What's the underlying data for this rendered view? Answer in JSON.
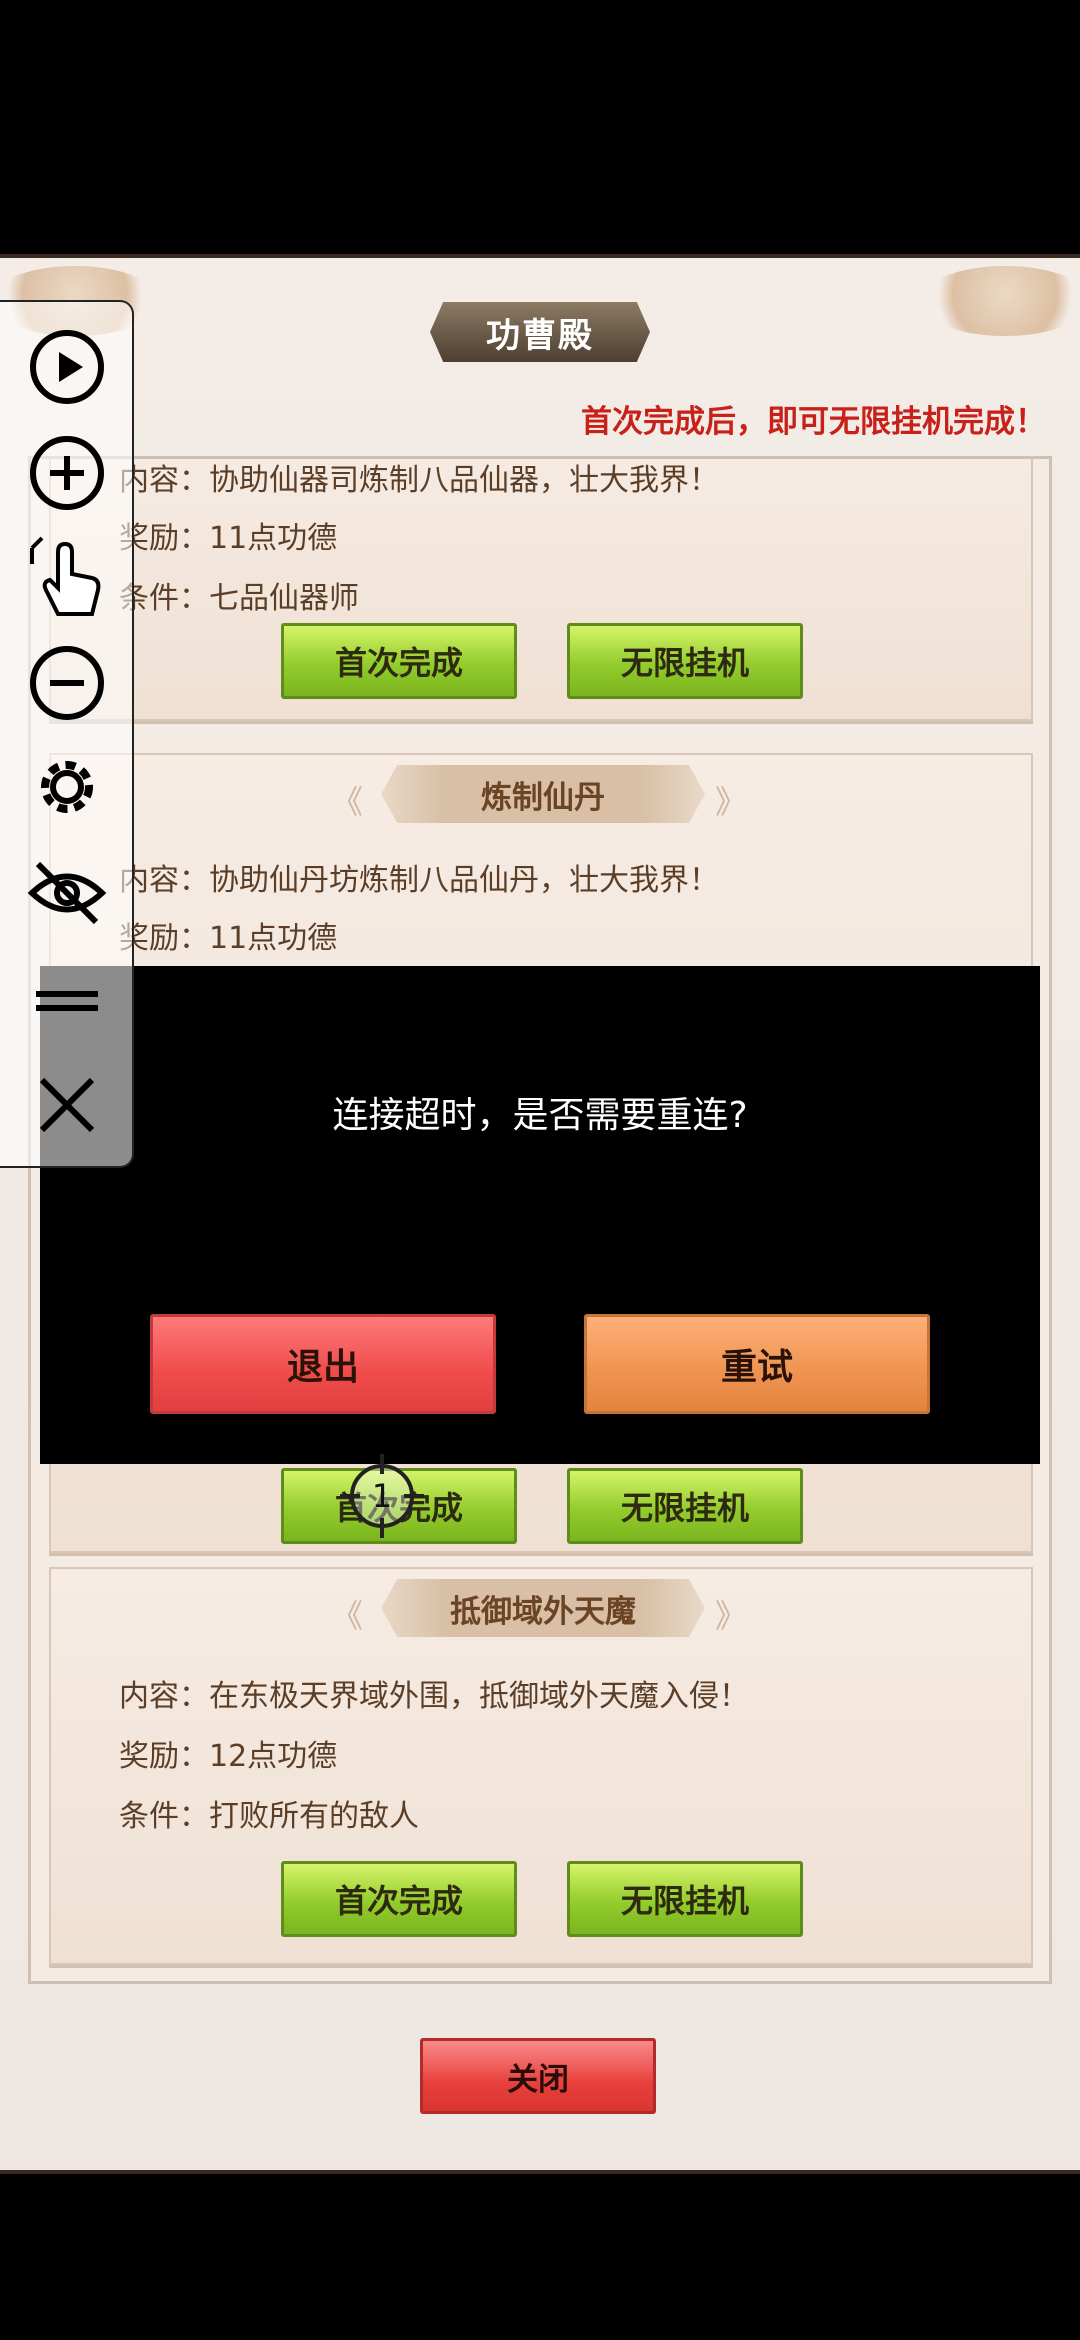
{
  "header": {
    "title": "功曹殿",
    "tip": "首次完成后，即可无限挂机完成！"
  },
  "cards": [
    {
      "content": "内容：协助仙器司炼制八品仙器，壮大我界！",
      "reward": "奖励：11点功德",
      "condition": "条件：七品仙器师",
      "first_label": "首次完成",
      "idle_label": "无限挂机"
    },
    {
      "title": "炼制仙丹",
      "content": "内容：协助仙丹坊炼制八品仙丹，壮大我界！",
      "reward": "奖励：11点功德",
      "first_label": "首次完成",
      "idle_label": "无限挂机"
    },
    {
      "title": "抵御域外天魔",
      "content": "内容：在东极天界域外围，抵御域外天魔入侵！",
      "reward": "奖励：12点功德",
      "condition": "条件：打败所有的敌人",
      "first_label": "首次完成",
      "idle_label": "无限挂机"
    }
  ],
  "footer": {
    "close_label": "关闭"
  },
  "dialog": {
    "message": "连接超时，是否需要重连?",
    "exit_label": "退出",
    "retry_label": "重试"
  },
  "overlay": {
    "crosshair_number": "1"
  },
  "toolbar": {
    "items": [
      "play-icon",
      "zoom-in-icon",
      "touch-icon",
      "zoom-out-icon",
      "gear-icon",
      "eye-off-icon",
      "drag-handle-icon",
      "close-icon"
    ]
  }
}
